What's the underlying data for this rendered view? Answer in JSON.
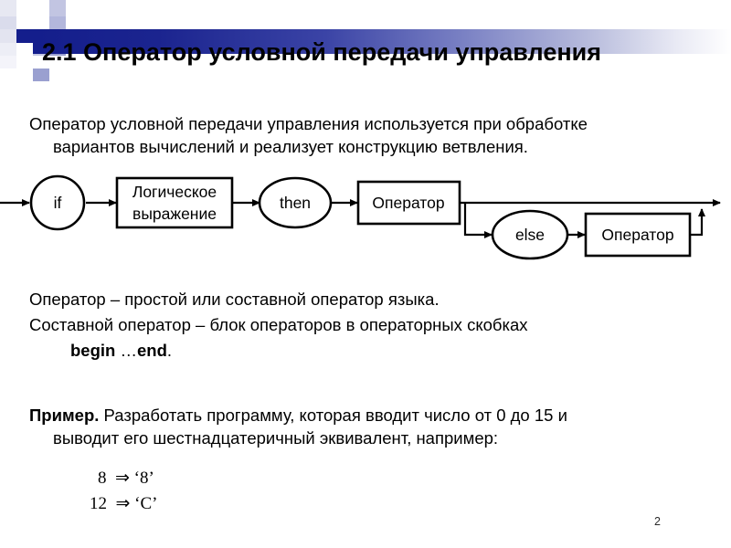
{
  "slide": {
    "number": "2",
    "title": "2.1 Оператор условной передачи управления",
    "accent_color": "#141e8c",
    "background_color": "#ffffff",
    "text_color": "#000000"
  },
  "intro": {
    "line1": "Оператор условной передачи управления используется при обработке",
    "line2": "вариантов вычислений и реализует конструкцию ветвления."
  },
  "diagram": {
    "name": "syntax-railroad-diagram",
    "nodes": {
      "if": "if",
      "condition_line1": "Логическое",
      "condition_line2": "выражение",
      "then": "then",
      "operator1": "Оператор",
      "else": "else",
      "operator2": "Оператор"
    }
  },
  "notes": {
    "line_a": "Оператор – простой или составной оператор языка.",
    "line_b": "Составной оператор – блок операторов в операторных скобках",
    "keyword_begin": "begin",
    "ellipsis": " …",
    "keyword_end": "end",
    "period": "."
  },
  "example": {
    "label": "Пример.",
    "text_line1": " Разработать программу, которая вводит число от 0 до 15 и",
    "text_line2": "выводит его шестнадцатеричный эквивалент, например:",
    "rows": [
      {
        "input": "8",
        "arrow": "⇒",
        "output": "‘8’"
      },
      {
        "input": "12",
        "arrow": "⇒",
        "output": "‘C’"
      }
    ],
    "row1": "8  ⇒ ‘8’",
    "row2": "12  ⇒ ‘C’"
  }
}
